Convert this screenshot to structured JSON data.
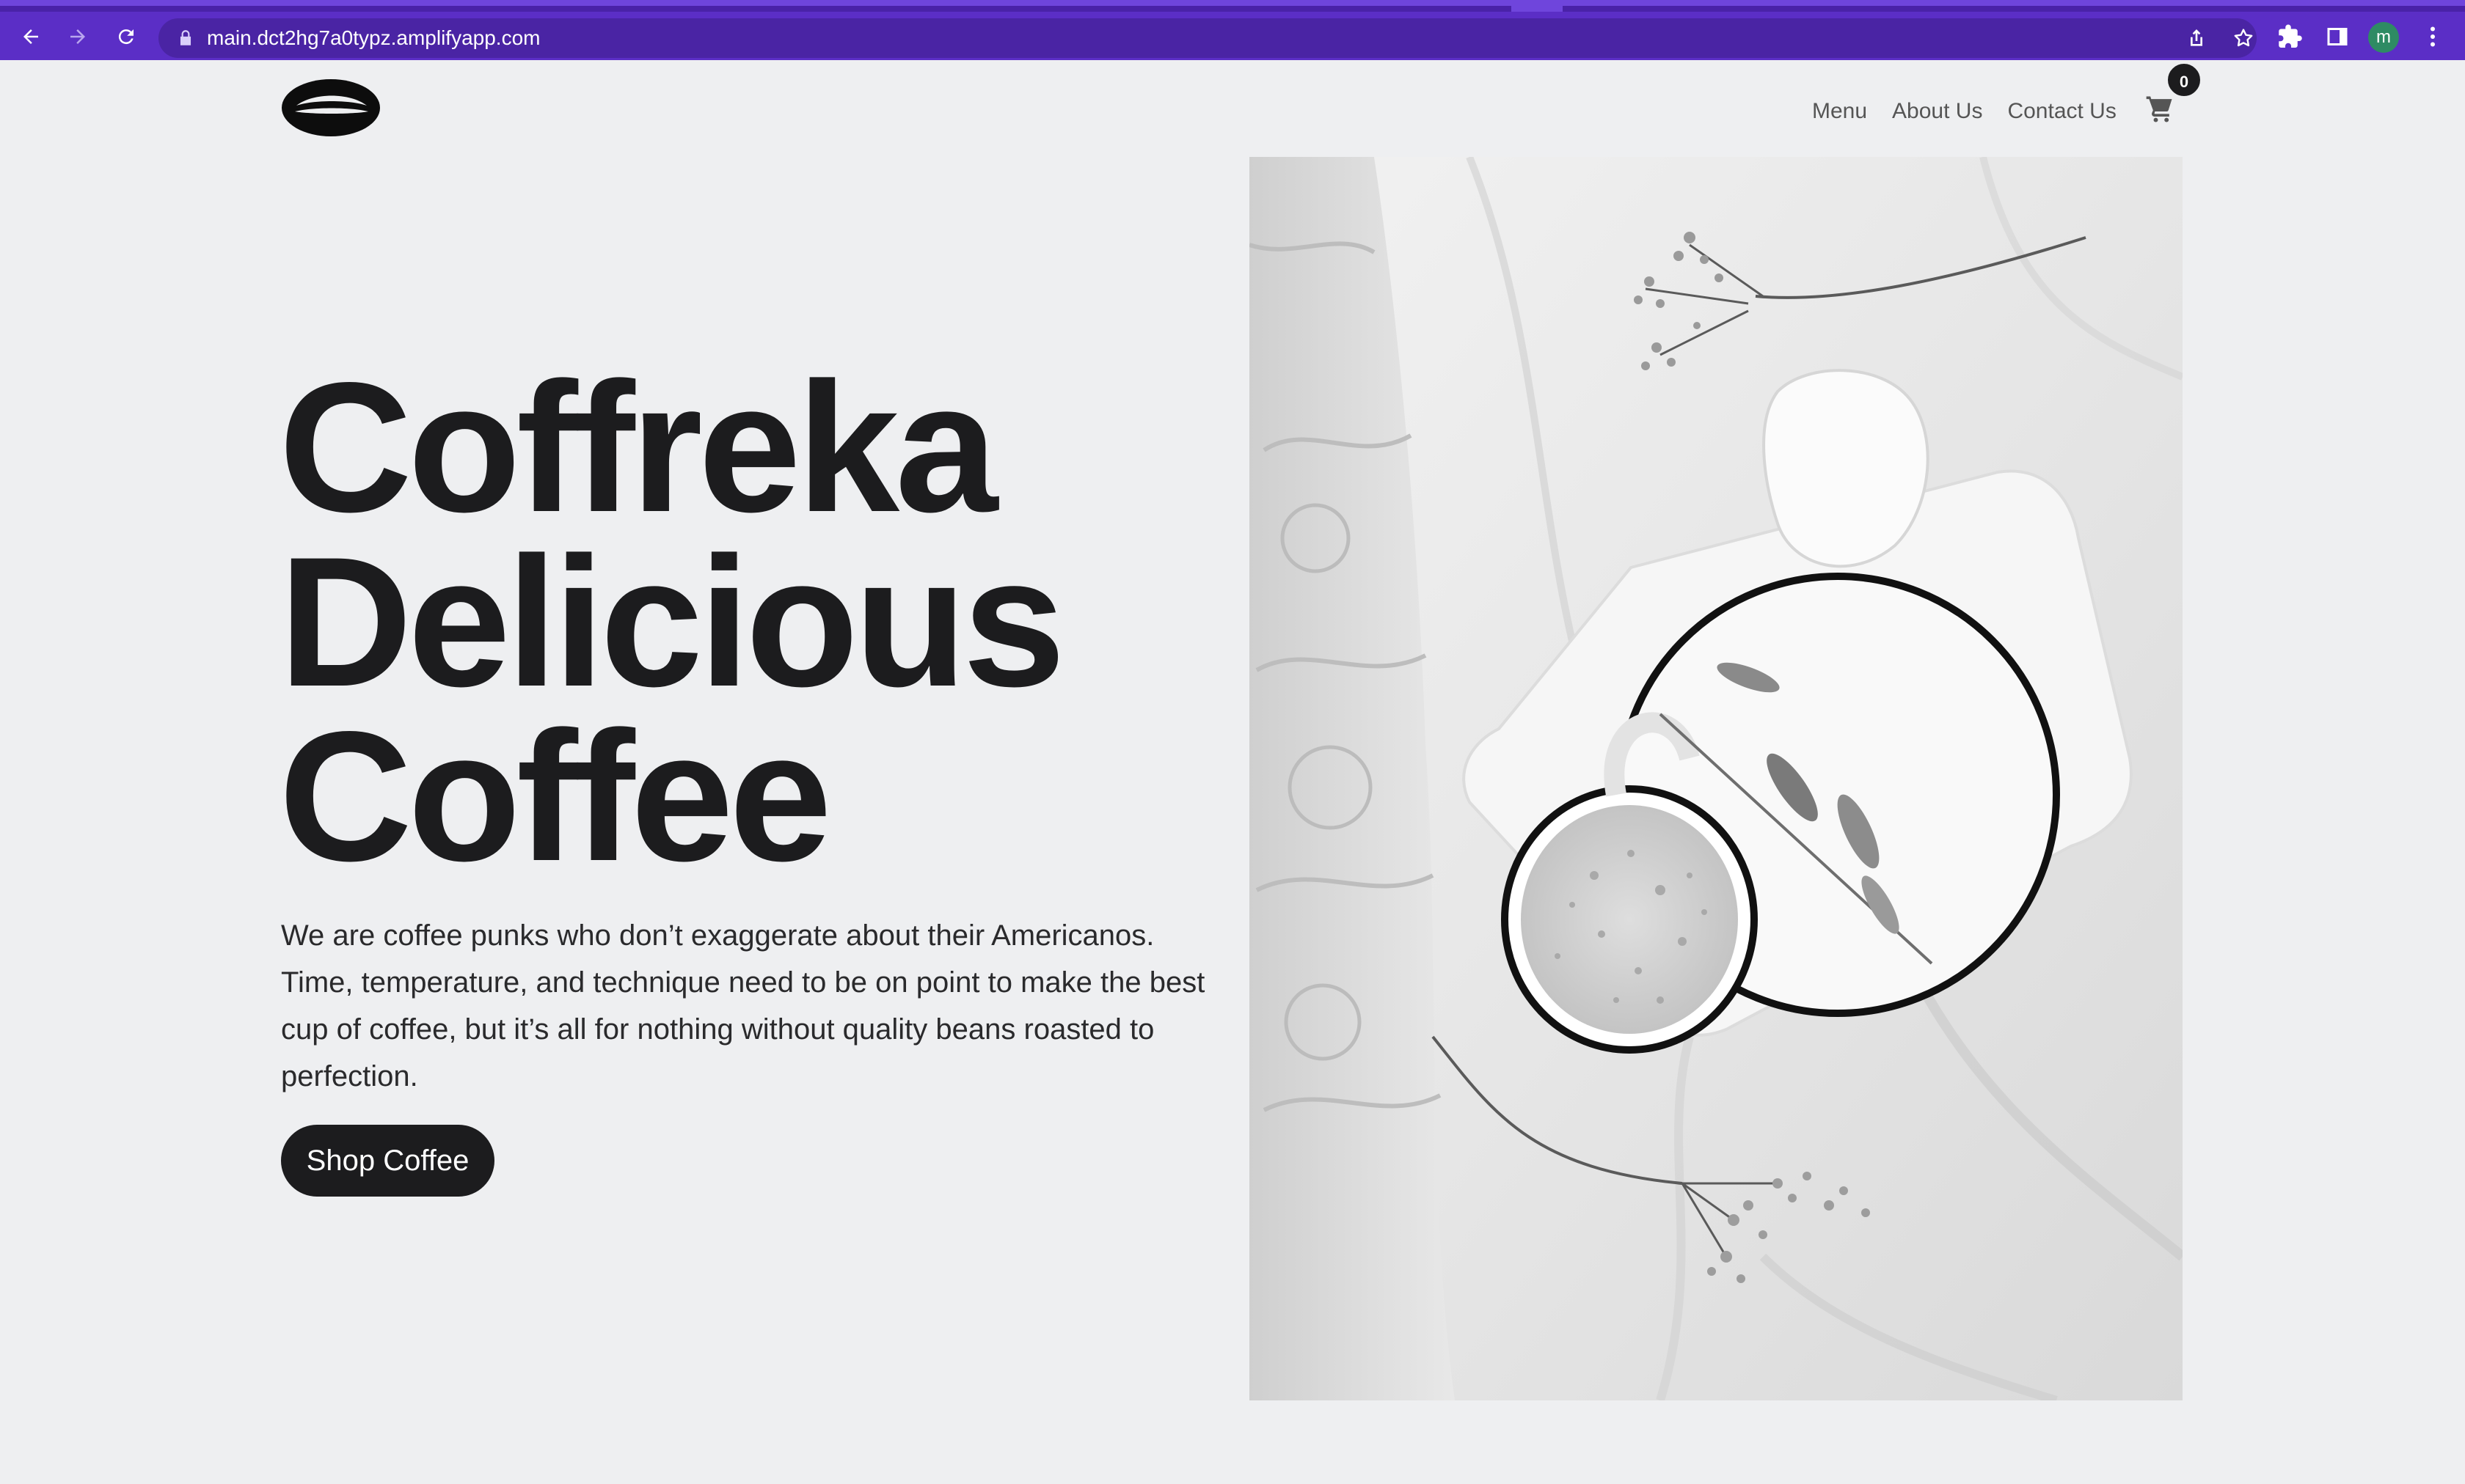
{
  "browser": {
    "url": "main.dct2hg7a0typz.amplifyapp.com",
    "profile_initial": "m",
    "icons": [
      "back-arrow-icon",
      "forward-arrow-icon",
      "reload-icon",
      "lock-icon",
      "share-icon",
      "star-icon",
      "extensions-icon",
      "side-panel-icon",
      "more-vert-icon"
    ],
    "accent_color": "#5b2ec6"
  },
  "header": {
    "logo_icon": "coffee-bean-logo-icon",
    "nav": {
      "menu": "Menu",
      "about": "About Us",
      "contact": "Contact Us"
    },
    "cart_icon": "cart-icon",
    "cart_count": "0"
  },
  "hero": {
    "title_line1": "Coffreka",
    "title_line2": "Delicious",
    "title_line3": "Coffee",
    "description": "We are coffee punks who don’t exaggerate about their Americanos. Time, temperature, and technique need to be on point to make the best cup of coffee, but it’s all for nothing without quality beans roasted to perfection.",
    "cta_label": "Shop Coffee",
    "image": "coffee-cup-on-bedsheet-photo"
  },
  "colors": {
    "page_background": "#eeeff1",
    "text_dark": "#1c1c1e",
    "nav_text": "#555555"
  }
}
